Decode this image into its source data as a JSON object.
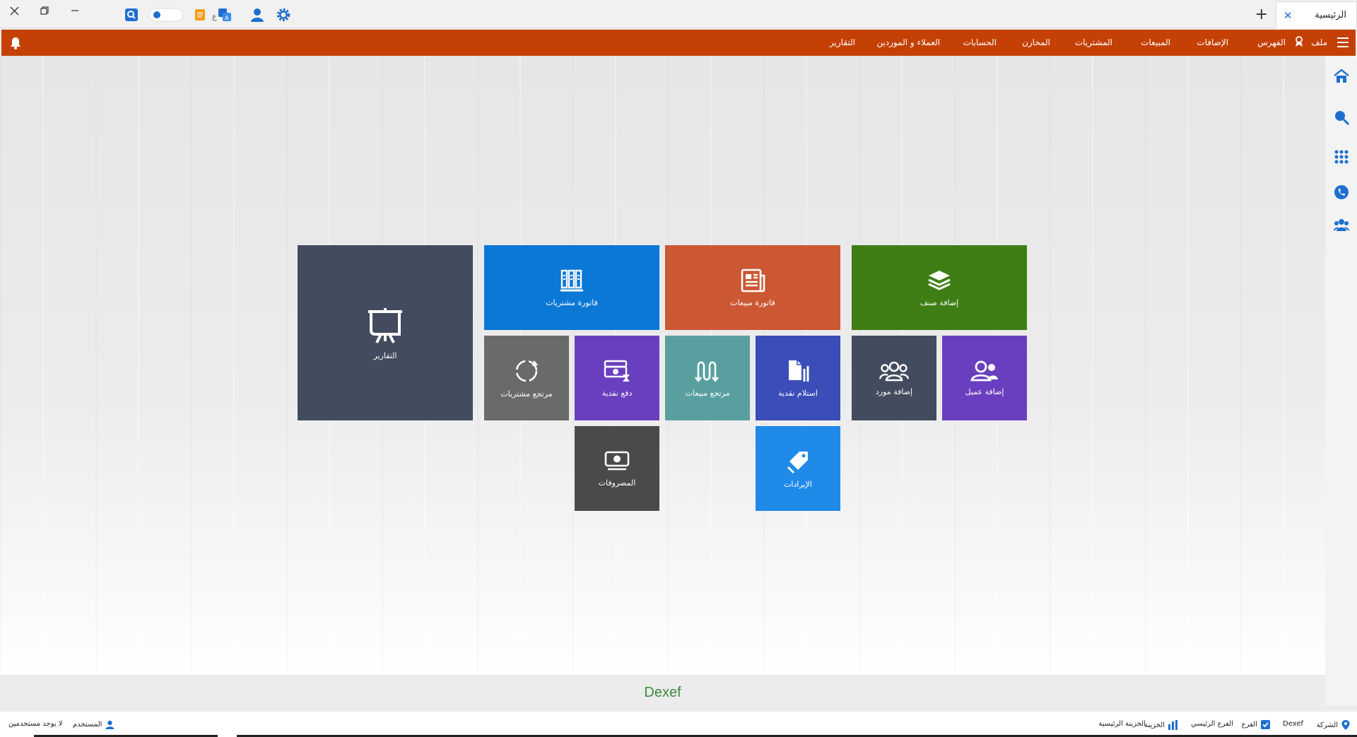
{
  "tab": {
    "label": "الرئيسية"
  },
  "menubar": {
    "items": [
      "ملف",
      "الفهرس",
      "الإضافات",
      "المبيعات",
      "المشتريات",
      "المخازن",
      "الحسابات",
      "العملاء و الموردين",
      "التقارير"
    ]
  },
  "tiles": {
    "add_item": "إضافة صنف",
    "sales_invoice": "فاتورة مبيعات",
    "purchase_invoice": "فاتورة مشتريات",
    "reports": "التقارير",
    "add_customer": "إضافة عميل",
    "add_supplier": "إضافة مورد",
    "cash_receipt": "استلام نقدية",
    "sales_return": "مرتجع مبيعات",
    "cash_payment": "دفع نقدية",
    "purchase_return": "مرتجع مشتريات",
    "revenues": "الإيرادات",
    "expenses": "المصروفات"
  },
  "brand": "Dexef",
  "statusbar": {
    "company_label": "الشركة",
    "company_value": "Dexef",
    "branch_label": "الفرع",
    "branch_value": "الفرع الرئيسي",
    "treasury_label": "الخزينة",
    "treasury_value": "الخزينة الرئيسية",
    "user_label": "المستخدم",
    "user_value": "لا يوجد مستخدمين"
  },
  "colors": {
    "menubar": "#c44005",
    "tile_green": "#3e7e14",
    "tile_orange": "#cc5733",
    "tile_blue": "#0a78d4",
    "tile_slate": "#434b5e",
    "tile_purple": "#6a3fbf",
    "tile_teal": "#5a9fa0",
    "tile_indigo": "#3b4db8",
    "tile_gray": "#6a6a6a",
    "tile_dark": "#4a4a4a",
    "tile_sky": "#1f8ae8"
  }
}
